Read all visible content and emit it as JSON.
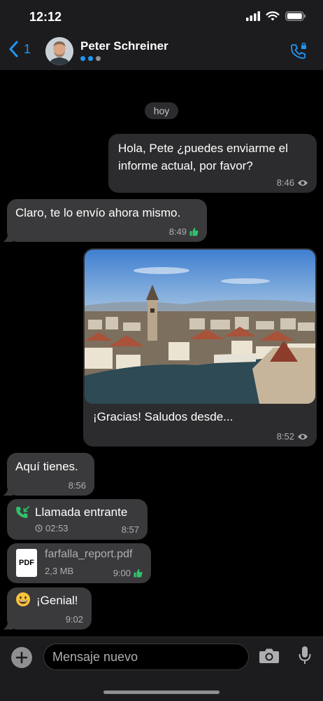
{
  "status_bar": {
    "time": "12:12"
  },
  "header": {
    "back_count": "1",
    "contact_name": "Peter Schreiner",
    "accent_color": "#2196f3"
  },
  "chat": {
    "date_label": "hoy",
    "messages": [
      {
        "direction": "out",
        "text": "Hola, Pete ¿puedes enviarme el informe actual, por favor?",
        "time": "8:46",
        "status_icon": "eye-icon"
      },
      {
        "direction": "in",
        "text": "Claro, te lo envío ahora mismo.",
        "time": "8:49",
        "status_icon": "thumbs-up-icon"
      },
      {
        "direction": "out",
        "type": "image",
        "caption": "¡Gracias! Saludos desde...",
        "time": "8:52",
        "status_icon": "eye-icon"
      },
      {
        "direction": "in",
        "text": "Aquí tienes.",
        "time": "8:56"
      },
      {
        "direction": "in",
        "type": "call",
        "title": "Llamada entrante",
        "duration": "02:53",
        "time": "8:57"
      },
      {
        "direction": "in",
        "type": "file",
        "file_badge": "PDF",
        "file_name": "farfalla_report.pdf",
        "file_size": "2,3 MB",
        "time": "9:00",
        "status_icon": "thumbs-up-icon"
      },
      {
        "direction": "in",
        "type": "emoji",
        "emoji": "😀",
        "text": "¡Genial!",
        "time": "9:02"
      }
    ]
  },
  "input": {
    "placeholder": "Mensaje nuevo"
  }
}
